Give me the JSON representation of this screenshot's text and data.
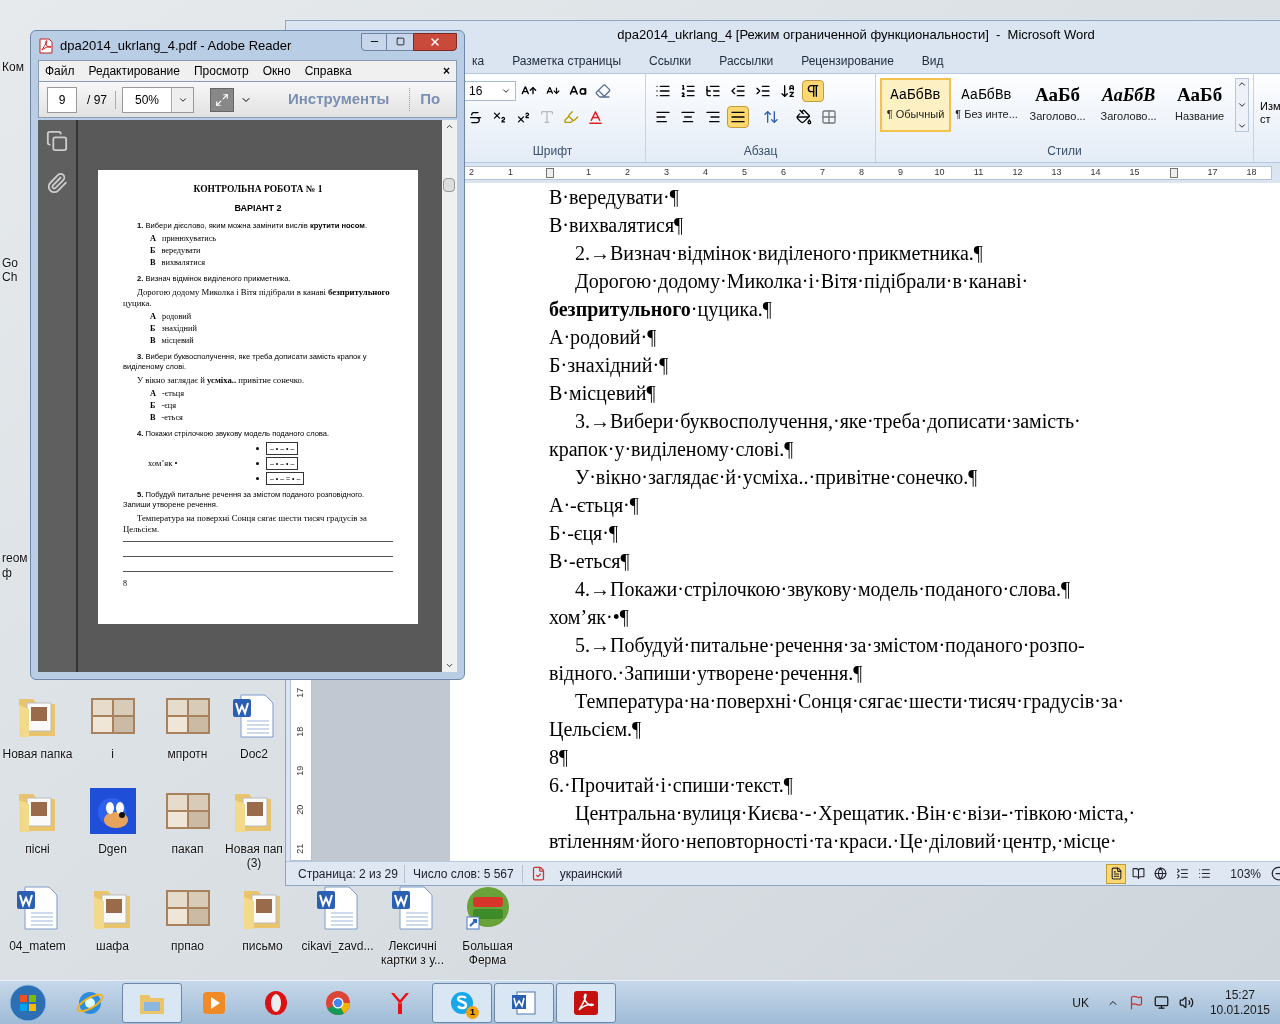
{
  "desktop": {
    "edge_labels": [
      "Ком",
      "Go",
      "Ch",
      "reoм",
      "ф"
    ],
    "icons": [
      {
        "label": "Новая папка",
        "kind": "folder"
      },
      {
        "label": "i",
        "kind": "photo"
      },
      {
        "label": "мпротн",
        "kind": "photo"
      },
      {
        "label": "Doc2",
        "kind": "document"
      },
      {
        "label": "пісні",
        "kind": "folder"
      },
      {
        "label": "Dgen",
        "kind": "game"
      },
      {
        "label": "пакап",
        "kind": "photo"
      },
      {
        "label": "Новая пап (3)",
        "kind": "folder"
      },
      {
        "label": "04_matem",
        "kind": "document"
      },
      {
        "label": "шафа",
        "kind": "folder"
      },
      {
        "label": "прпао",
        "kind": "photo"
      },
      {
        "label": "письмо",
        "kind": "folder"
      },
      {
        "label": "cikavi_zavd...",
        "kind": "document"
      },
      {
        "label": "Лексичні картки з у...",
        "kind": "document"
      },
      {
        "label": "Большая Ферма",
        "kind": "shortcut"
      }
    ]
  },
  "word": {
    "title": "dpa2014_ukrlang_4 [Режим ограниченной функциональности]  -  Microsoft Word",
    "tabs": [
      "ка",
      "Разметка страницы",
      "Ссылки",
      "Рассылки",
      "Рецензирование",
      "Вид"
    ],
    "font_size": "16",
    "groups": [
      "Шрифт",
      "Абзац",
      "Стили"
    ],
    "paragraph_tools": [
      {
        "kind": "bullets",
        "selected": false
      },
      {
        "kind": "numbering",
        "selected": false
      },
      {
        "kind": "multilevel",
        "selected": false
      },
      {
        "kind": "outdent",
        "selected": false
      },
      {
        "kind": "indent",
        "selected": false
      },
      {
        "kind": "sort",
        "selected": false
      },
      {
        "kind": "marks",
        "selected": true
      }
    ],
    "alignment": [
      {
        "kind": "left",
        "selected": false
      },
      {
        "kind": "center",
        "selected": false
      },
      {
        "kind": "right",
        "selected": false
      },
      {
        "kind": "justify",
        "selected": true
      }
    ],
    "styles": [
      {
        "preview": "АаБбВв",
        "label": "¶ Обычный",
        "kind": "normal",
        "selected": true
      },
      {
        "preview": "АаБбВв",
        "label": "¶ Без инте...",
        "kind": "plain",
        "selected": false
      },
      {
        "preview": "АаБб",
        "label": "Заголово...",
        "kind": "heading",
        "selected": false
      },
      {
        "preview": "АаБбВ",
        "label": "Заголово...",
        "kind": "heading-italic",
        "selected": false
      },
      {
        "preview": "АаБб",
        "label": "Название",
        "kind": "heading",
        "selected": false
      }
    ],
    "change_styles": [
      "Изм",
      "ст"
    ],
    "ruler": [
      "2",
      "1",
      "1",
      "2",
      "3",
      "4",
      "5",
      "6",
      "7",
      "8",
      "9",
      "10",
      "11",
      "12",
      "13",
      "14",
      "15",
      "17",
      "18"
    ],
    "vertical_ruler": [
      "17",
      "18",
      "19",
      "20",
      "21"
    ],
    "lines": [
      {
        "text": "В·вередувати·¶",
        "indent": false
      },
      {
        "text": "В·вихвалятися¶",
        "indent": false
      },
      {
        "text": "2.→Визнач·відмінок·виділеного·прикметника.¶",
        "indent": true
      },
      {
        "text": "Дорогою·додому·Миколка·і·Вітя·підібрали·в·канаві·",
        "indent": true
      },
      {
        "text": "**безпритульного**·цуцика.¶",
        "indent": false
      },
      {
        "text": "А·родовий·¶",
        "indent": false
      },
      {
        "text": "Б·знахідний·¶",
        "indent": false
      },
      {
        "text": "В·місцевий¶",
        "indent": false
      },
      {
        "text": "3.→Вибери·буквосполучення,·яке·треба·дописати·замість·",
        "indent": true
      },
      {
        "text": "крапок·у·виділеному·слові.¶",
        "indent": false
      },
      {
        "text": "У·вікно·заглядає·й·усміха..·привітне·сонечко.¶",
        "indent": true
      },
      {
        "text": "А·-єтьця·¶",
        "indent": false
      },
      {
        "text": "Б·-єця·¶",
        "indent": false
      },
      {
        "text": "В·-еться¶",
        "indent": false
      },
      {
        "text": "4.→Покажи·стрілочкою·звукову·модель·поданого·слова.¶",
        "indent": true
      },
      {
        "text": "хом’як·•¶",
        "indent": false
      },
      {
        "text": "5.→Побудуй·питальне·речення·за·змістом·поданого·розпо-",
        "indent": true
      },
      {
        "text": "відного.·Запиши·утворене·речення.¶",
        "indent": false
      },
      {
        "text": "Температура·на·поверхні·Сонця·сягає·шести·тисяч·градусів·за·",
        "indent": true
      },
      {
        "text": "Цельсієм.¶",
        "indent": false
      },
      {
        "text": "8¶",
        "indent": false
      },
      {
        "text": "6.·Прочитай·і·спиши·текст.¶",
        "indent": false
      },
      {
        "text": "Центральна·вулиця·Києва·-·Хрещатик.·Він·є·візи-·тівкою·міста,·",
        "indent": true
      },
      {
        "text": "втіленням·його·неповторності·та·краси.·Це·діловий·центр,·місце·",
        "indent": false
      }
    ],
    "status": {
      "page": "Страница: 2 из 29",
      "words": "Число слов: 5 567",
      "language": "украинский",
      "zoom": "103%"
    },
    "views": [
      {
        "kind": "print",
        "selected": true
      },
      {
        "kind": "reading",
        "selected": false
      },
      {
        "kind": "web",
        "selected": false
      },
      {
        "kind": "outline",
        "selected": false
      },
      {
        "kind": "draft",
        "selected": false
      }
    ]
  },
  "reader": {
    "title": "dpa2014_ukrlang_4.pdf - Adobe Reader",
    "menu": [
      "Файл",
      "Редактирование",
      "Просмотр",
      "Окно",
      "Справка"
    ],
    "menu_close": "×",
    "page": "9",
    "page_count": "/ 97",
    "zoom": "50%",
    "tools": "Инструменты",
    "next_button": "По",
    "document": [
      {
        "kind": "heading",
        "text": "КОНТРОЛЬНА РОБОТА № 1"
      },
      {
        "kind": "subheading",
        "text": "ВАРІАНТ 2"
      },
      {
        "kind": "task",
        "text": "**1.** Вибери дієслово, яким можна замінити вислів **крутити носом**."
      },
      {
        "kind": "options",
        "options": [
          {
            "letter": "А",
            "text": "принюхуватись"
          },
          {
            "letter": "Б",
            "text": "вередувати"
          },
          {
            "letter": "В",
            "text": "вихвалятися"
          }
        ]
      },
      {
        "kind": "task",
        "text": "**2.** Визнач відмінок виділеного прикметника."
      },
      {
        "kind": "example",
        "text": "Дорогою додому Миколка і Вітя підібрали в канаві **безпритульного** цуцика."
      },
      {
        "kind": "options",
        "options": [
          {
            "letter": "А",
            "text": "родовий"
          },
          {
            "letter": "Б",
            "text": "знахідний"
          },
          {
            "letter": "В",
            "text": "місцевий"
          }
        ]
      },
      {
        "kind": "task",
        "text": "**3.** Вибери буквосполучення, яке треба дописати замість крапок у виділеному слові."
      },
      {
        "kind": "example",
        "text": "У вікно заглядає й **усміха..** привітне сонечко."
      },
      {
        "kind": "options",
        "options": [
          {
            "letter": "А",
            "text": "-єтьця"
          },
          {
            "letter": "Б",
            "text": "-єця"
          },
          {
            "letter": "В",
            "text": "-еться"
          }
        ]
      },
      {
        "kind": "task",
        "text": "**4.** Покажи стрілочкою звукову модель поданого слова."
      },
      {
        "kind": "model",
        "word": "хом’як •",
        "models": [
          "– • – • –",
          "– • – • –",
          "– • – = • –"
        ]
      },
      {
        "kind": "task",
        "text": "**5.** Побудуй питальне речення за змістом поданого розповідного. Запиши утворене речення."
      },
      {
        "kind": "example",
        "text": "Температура на поверхні Сонця сягає шести тисяч градусів за Цельсієм."
      },
      {
        "kind": "answer-lines"
      },
      {
        "kind": "page-number",
        "text": "8"
      }
    ]
  },
  "taskbar": {
    "apps": [
      {
        "kind": "ie",
        "running": false
      },
      {
        "kind": "explorer",
        "running": true
      },
      {
        "kind": "media",
        "running": false
      },
      {
        "kind": "opera",
        "running": false
      },
      {
        "kind": "chrome",
        "running": false
      },
      {
        "kind": "yandex",
        "running": false
      },
      {
        "kind": "skype",
        "running": true,
        "badge": "1"
      },
      {
        "kind": "word",
        "running": true
      },
      {
        "kind": "acrobat",
        "running": true
      }
    ],
    "language": "UK",
    "time": "15:27",
    "date": "10.01.2015"
  }
}
